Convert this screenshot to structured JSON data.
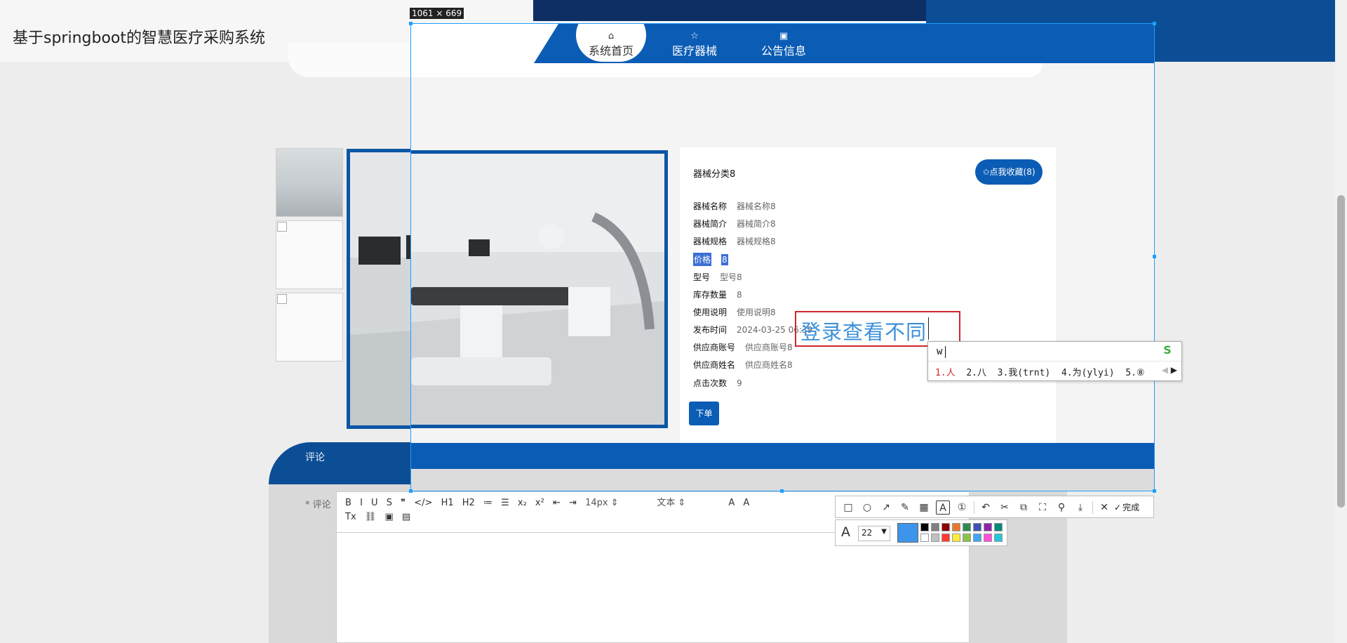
{
  "site": {
    "title": "基于springboot的智慧医疗采购系统"
  },
  "capture": {
    "size_label": "1061 × 669"
  },
  "nav": {
    "items": [
      {
        "label": "系统首页",
        "icon": "home-icon",
        "glyph": "⌂"
      },
      {
        "label": "医疗器械",
        "icon": "star-icon",
        "glyph": "☆"
      },
      {
        "label": "公告信息",
        "icon": "bag-icon",
        "glyph": "▣"
      }
    ]
  },
  "product": {
    "category": "器械分类8",
    "favorite_label": "✩点我收藏(8)",
    "fields": [
      {
        "key": "器械名称",
        "value": "器械名称8"
      },
      {
        "key": "器械简介",
        "value": "器械简介8"
      },
      {
        "key": "器械规格",
        "value": "器械规格8"
      },
      {
        "key": "价格",
        "value": "8"
      },
      {
        "key": "型号",
        "value": "型号8"
      },
      {
        "key": "库存数量",
        "value": "8"
      },
      {
        "key": "使用说明",
        "value": "使用说明8"
      },
      {
        "key": "发布时间",
        "value": "2024-03-25 06:39"
      },
      {
        "key": "供应商账号",
        "value": "供应商账号8"
      },
      {
        "key": "供应商姓名",
        "value": "供应商姓名8"
      },
      {
        "key": "点击次数",
        "value": "9"
      }
    ],
    "order_label": "下单"
  },
  "comment": {
    "tab": "评论",
    "label": "* 评论",
    "toolbar": [
      "B",
      "I",
      "U",
      "S",
      "❞",
      "</>",
      "H1",
      "H2",
      "≔",
      "☰",
      "x₂",
      "x²",
      "⇤",
      "⇥",
      "14px ⇕",
      "文本 ⇕",
      "A",
      "A",
      "Tx",
      "⛓",
      "▣",
      "▤"
    ],
    "font_size": "14px",
    "font_style": "文本"
  },
  "annotation": {
    "text": "登录查看不同"
  },
  "ime": {
    "input": "w",
    "candidates": [
      "1.人",
      "2.八",
      "3.我(trnt)",
      "4.为(ylyi)",
      "5.⑧"
    ],
    "logo": "S"
  },
  "screenshot_toolbar": {
    "tools": [
      "rectangle-icon",
      "ellipse-icon",
      "arrow-icon",
      "pen-icon",
      "mosaic-icon",
      "text-icon",
      "number-icon",
      "undo-icon",
      "cut-icon",
      "copy-icon",
      "ocr-icon",
      "pin-icon",
      "download-icon",
      "close-icon"
    ],
    "glyphs": [
      "□",
      "○",
      "↗",
      "✎",
      "▦",
      "A",
      "①",
      "↶",
      "✂",
      "⧉",
      "⛶",
      "⚲",
      "⤓",
      "✕"
    ],
    "done_label": "完成",
    "font_size": "22",
    "current_color": "#3c95ea",
    "palette": [
      "#000000",
      "#808080",
      "#8b0000",
      "#e8772e",
      "#2e8b57",
      "#3f51b5",
      "#8e24aa",
      "#00897b",
      "#ffffff",
      "#c0c0c0",
      "#ff3b30",
      "#ffeb3b",
      "#8bc34a",
      "#42a5f5",
      "#ff4fd8",
      "#26c6da"
    ]
  }
}
